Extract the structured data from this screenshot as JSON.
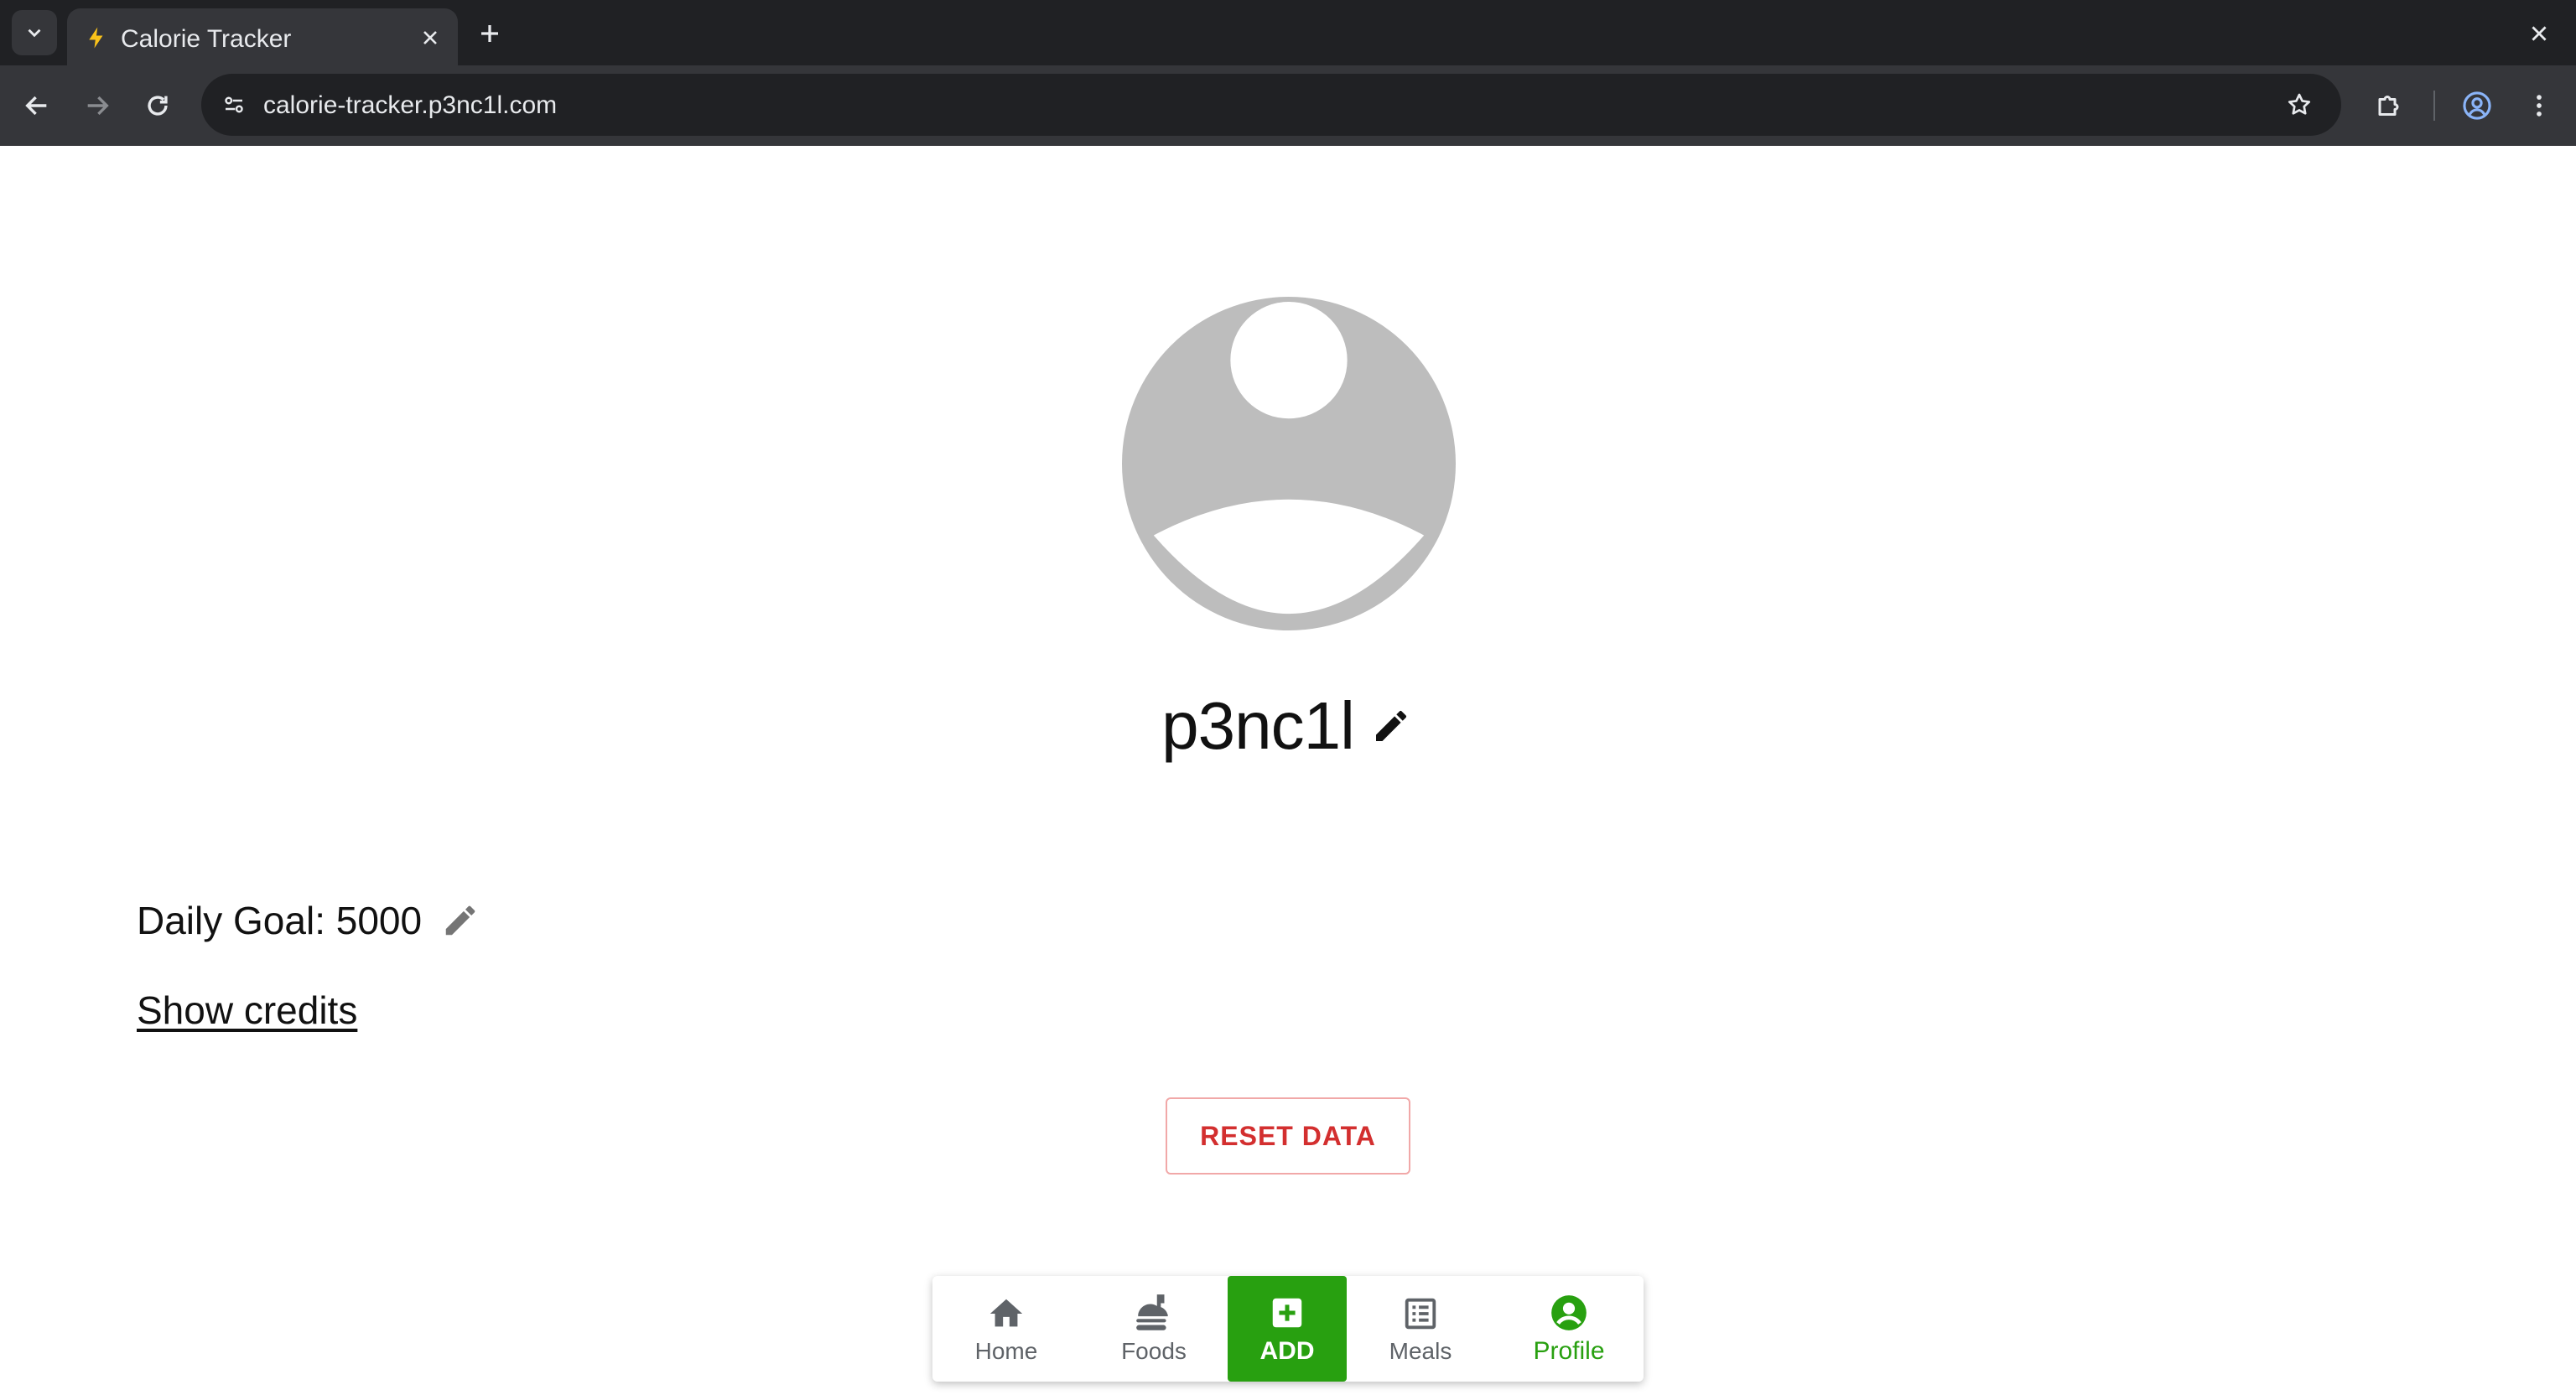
{
  "browser": {
    "tab_title": "Calorie Tracker",
    "url": "calorie-tracker.p3nc1l.com"
  },
  "profile": {
    "username": "p3nc1l",
    "daily_goal_label": "Daily Goal: 5000",
    "show_credits_label": "Show credits",
    "reset_label": "RESET DATA"
  },
  "bottom_nav": {
    "items": [
      {
        "label": "Home",
        "icon": "home-icon"
      },
      {
        "label": "Foods",
        "icon": "food-icon"
      },
      {
        "label": "ADD",
        "icon": "add-box-icon"
      },
      {
        "label": "Meals",
        "icon": "list-icon"
      },
      {
        "label": "Profile",
        "icon": "account-circle-icon"
      }
    ],
    "active": "Profile"
  },
  "colors": {
    "accent": "#28a010",
    "danger": "#d32f2f",
    "avatar_gray": "#bdbdbd",
    "chrome_dark": "#202124",
    "chrome_toolbar": "#35363a"
  }
}
